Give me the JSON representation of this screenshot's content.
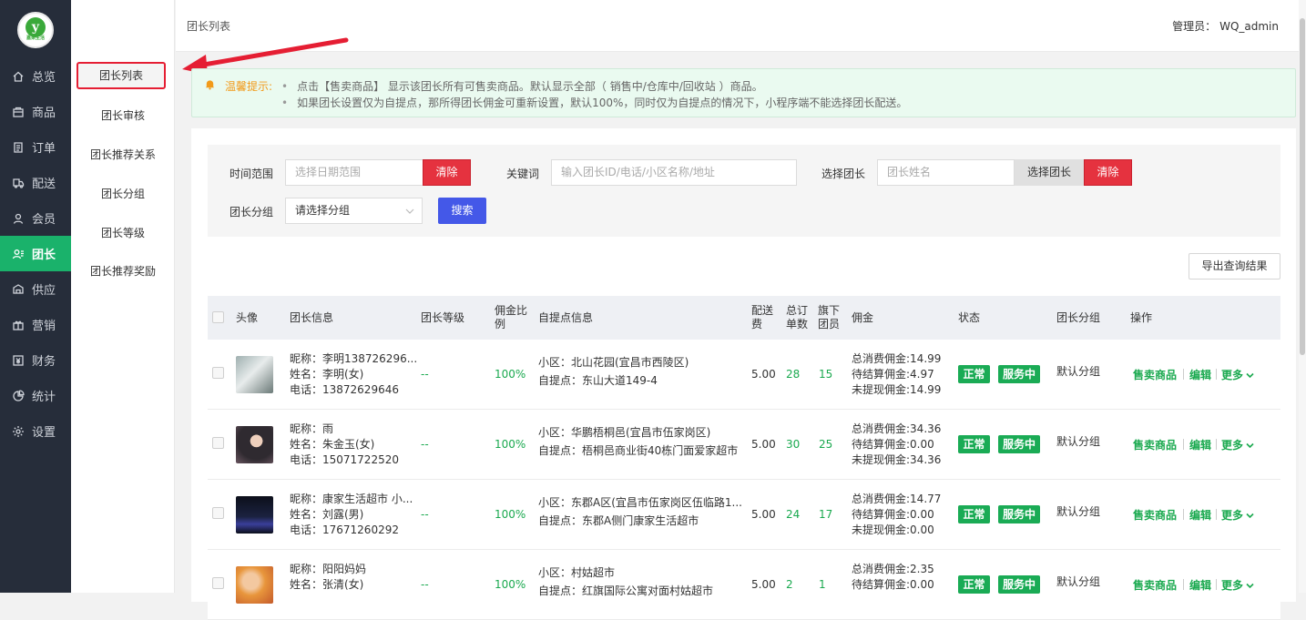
{
  "brand": {
    "logo_glyph": "y",
    "logo_text": "嘉果生活",
    "logo_color": "#3aa93a"
  },
  "sidebar": {
    "items": [
      {
        "label": "总览",
        "icon": "home-icon"
      },
      {
        "label": "商品",
        "icon": "box-icon"
      },
      {
        "label": "订单",
        "icon": "order-icon"
      },
      {
        "label": "配送",
        "icon": "delivery-icon"
      },
      {
        "label": "会员",
        "icon": "user-icon"
      },
      {
        "label": "团长",
        "icon": "leader-icon",
        "active": true
      },
      {
        "label": "供应",
        "icon": "supply-icon"
      },
      {
        "label": "营销",
        "icon": "gift-icon"
      },
      {
        "label": "财务",
        "icon": "finance-icon"
      },
      {
        "label": "统计",
        "icon": "chart-icon"
      },
      {
        "label": "设置",
        "icon": "gear-icon"
      }
    ],
    "active_color": "#1ab26b"
  },
  "subnav": {
    "items": [
      "团长列表",
      "团长审核",
      "团长推荐关系",
      "团长分组",
      "团长等级",
      "团长推荐奖励"
    ],
    "active_index": 0
  },
  "header": {
    "page_title": "团长列表",
    "admin_prefix": "管理员：",
    "admin_name": "WQ_admin"
  },
  "notice": {
    "title": "温馨提示:",
    "lines": [
      "点击【售卖商品】 显示该团长所有可售卖商品。默认显示全部（ 销售中/仓库中/回收站 ）商品。",
      "如果团长设置仅为自提点，那所得团长佣金可重新设置，默认100%，同时仅为自提点的情况下，小程序端不能选择团长配送。"
    ]
  },
  "filter": {
    "time_label": "时间范围",
    "time_placeholder": "选择日期范围",
    "clear_label": "清除",
    "keyword_label": "关键词",
    "keyword_placeholder": "输入团长ID/电话/小区名称/地址",
    "leader_label": "选择团长",
    "leader_placeholder": "团长姓名",
    "choose_leader_label": "选择团长",
    "clear2_label": "清除",
    "group_label": "团长分组",
    "group_value": "请选择分组",
    "search_label": "搜索"
  },
  "export_label": "导出查询结果",
  "table": {
    "headers": {
      "avatar": "头像",
      "info": "团长信息",
      "level": "团长等级",
      "ratio": "佣金比例",
      "pickup": "自提点信息",
      "fee": "配送费",
      "orders": "总订单数",
      "members": "旗下团员",
      "commission": "佣金",
      "status": "状态",
      "group": "团长分组",
      "ops": "操作"
    },
    "rows": [
      {
        "nickname": "昵称：李明138726296...",
        "name": "姓名：李明(女)",
        "phone": "电话：13872629646",
        "level": "--",
        "ratio": "100%",
        "community": "小区：北山花园(宜昌市西陵区)",
        "pickup": "自提点：东山大道149-4",
        "fee": "5.00",
        "orders": "28",
        "members": "15",
        "c_total": "总消费佣金:14.99",
        "c_pending": "待结算佣金:4.97",
        "c_unwithdrawn": "未提现佣金:14.99",
        "status": "正常",
        "service": "服务中",
        "group": "默认分组",
        "op_sell": "售卖商品",
        "op_edit": "编辑",
        "op_more": "更多"
      },
      {
        "nickname": "昵称：雨",
        "name": "姓名：朱金玉(女)",
        "phone": "电话：15071722520",
        "level": "--",
        "ratio": "100%",
        "community": "小区：华鹏梧桐邑(宜昌市伍家岗区)",
        "pickup": "自提点：梧桐邑商业街40栋门面爱家超市",
        "fee": "5.00",
        "orders": "30",
        "members": "25",
        "c_total": "总消费佣金:34.36",
        "c_pending": "待结算佣金:0.00",
        "c_unwithdrawn": "未提现佣金:34.36",
        "status": "正常",
        "service": "服务中",
        "group": "默认分组",
        "op_sell": "售卖商品",
        "op_edit": "编辑",
        "op_more": "更多"
      },
      {
        "nickname": "昵称：康家生活超市 小...",
        "name": "姓名：刘露(男)",
        "phone": "电话：17671260292",
        "level": "--",
        "ratio": "100%",
        "community": "小区：东郡A区(宜昌市伍家岗区伍临路1...",
        "pickup": "自提点：东郡A侧门康家生活超市",
        "fee": "5.00",
        "orders": "24",
        "members": "17",
        "c_total": "总消费佣金:14.77",
        "c_pending": "待结算佣金:0.00",
        "c_unwithdrawn": "未提现佣金:0.00",
        "status": "正常",
        "service": "服务中",
        "group": "默认分组",
        "op_sell": "售卖商品",
        "op_edit": "编辑",
        "op_more": "更多"
      },
      {
        "nickname": "昵称：阳阳妈妈",
        "name": "姓名：张清(女)",
        "phone": "",
        "level": "--",
        "ratio": "100%",
        "community": "小区：村姑超市",
        "pickup": "自提点：红旗国际公寓对面村姑超市",
        "fee": "5.00",
        "orders": "2",
        "members": "1",
        "c_total": "总消费佣金:2.35",
        "c_pending": "待结算佣金:0.00",
        "c_unwithdrawn": "",
        "status": "正常",
        "service": "服务中",
        "group": "默认分组",
        "op_sell": "售卖商品",
        "op_edit": "编辑",
        "op_more": "更多"
      }
    ]
  }
}
